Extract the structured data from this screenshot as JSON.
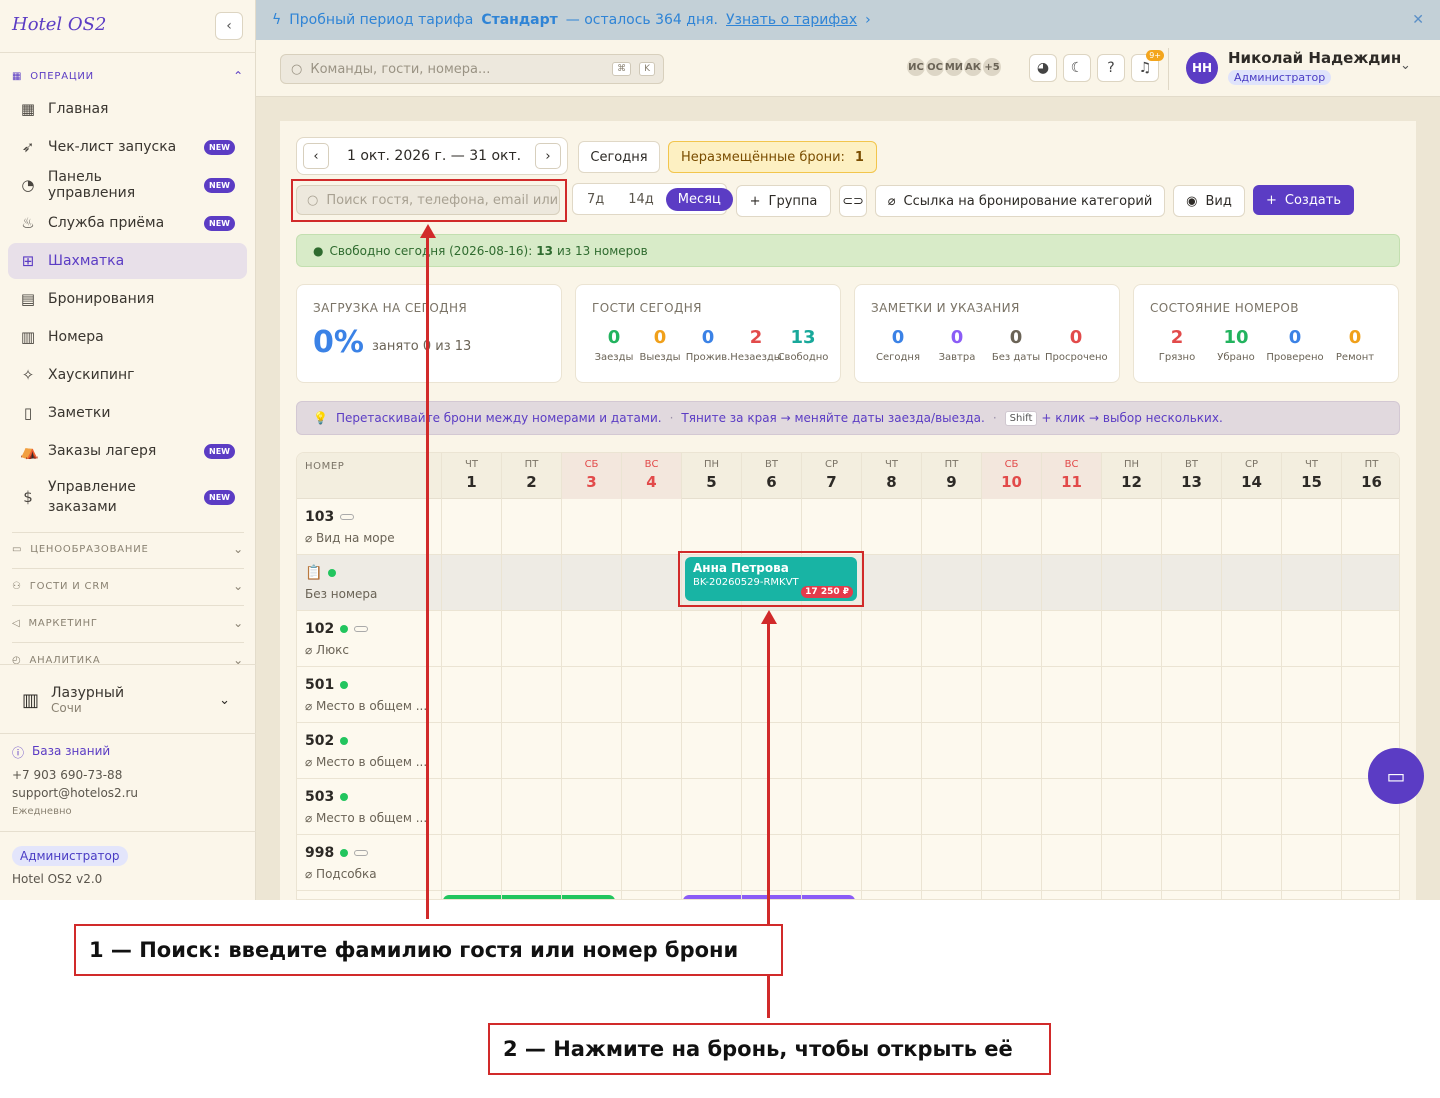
{
  "app": {
    "brand": "Hotel OS2",
    "version": "Hotel OS2 v2.0"
  },
  "banner": {
    "prefix": "Пробный период тарифа",
    "plan": "Стандарт",
    "suffix": "— осталось 364 дня.",
    "link": "Узнать о тарифах"
  },
  "sidebar": {
    "operations_label": "ОПЕРАЦИИ",
    "items": [
      {
        "label": "Главная",
        "icon": "dashboard-icon",
        "new": false
      },
      {
        "label": "Чек-лист запуска",
        "icon": "rocket-icon",
        "new": true
      },
      {
        "label": "Панель управления",
        "icon": "gauge-icon",
        "new": true
      },
      {
        "label": "Служба приёма",
        "icon": "bell-icon",
        "new": true
      },
      {
        "label": "Шахматка",
        "icon": "grid-icon",
        "new": false,
        "active": true
      },
      {
        "label": "Бронирования",
        "icon": "clipboard-icon",
        "new": false
      },
      {
        "label": "Номера",
        "icon": "building-icon",
        "new": false
      },
      {
        "label": "Хаускипинг",
        "icon": "sparkle-icon",
        "new": false
      },
      {
        "label": "Заметки",
        "icon": "note-icon",
        "new": false
      },
      {
        "label": "Заказы лагеря",
        "icon": "tent-icon",
        "new": true
      },
      {
        "label": "Управление заказами",
        "icon": "dollar-icon",
        "new": true
      }
    ],
    "new_badge": "NEW",
    "sections": [
      "ЦЕНООБРАЗОВАНИЕ",
      "ГОСТИ И CRM",
      "МАРКЕТИНГ",
      "АНАЛИТИКА"
    ],
    "hotel": {
      "name": "Лазурный",
      "city": "Сочи"
    },
    "kb_label": "База знаний",
    "phone": "+7 903 690-73-88",
    "email": "support@hotelos2.ru",
    "schedule": "Ежедневно",
    "role": "Администратор"
  },
  "header": {
    "search_placeholder": "Команды, гости, номера...",
    "kbd1": "⌘",
    "kbd2": "K",
    "avatars": [
      "ИС",
      "ОС",
      "МИ",
      "АК",
      "+5"
    ],
    "notif_count": "9+",
    "user": {
      "initials": "НН",
      "name": "Николай Надеждин",
      "role": "Администратор"
    }
  },
  "toolbar": {
    "date_range": "1 окт. 2026 г. — 31 окт.",
    "today": "Сегодня",
    "unplaced_label": "Неразмещённые брони:",
    "unplaced_count": "1",
    "guest_search_placeholder": "Поиск гостя, телефона, email или",
    "ranges": [
      "7д",
      "14д",
      "Месяц"
    ],
    "group": "Группа",
    "link_btn": "Ссылка на бронирование категорий",
    "view": "Вид",
    "create": "Создать"
  },
  "free_today": {
    "text": "Свободно сегодня (2026-08-16):",
    "free": "13",
    "rest": "из 13 номеров"
  },
  "cards": {
    "load": {
      "title": "ЗАГРУЗКА НА СЕГОДНЯ",
      "value": "0%",
      "sub": "занято 0 из 13"
    },
    "guests": {
      "title": "ГОСТИ СЕГОДНЯ",
      "stats": [
        {
          "v": "0",
          "l": "Заезды",
          "c": "#22b35e"
        },
        {
          "v": "0",
          "l": "Выезды",
          "c": "#f0a01a"
        },
        {
          "v": "0",
          "l": "Прожив.",
          "c": "#3b82e6"
        },
        {
          "v": "2",
          "l": "Незаезды",
          "c": "#e24a4a"
        },
        {
          "v": "13",
          "l": "Свободно",
          "c": "#18a89a"
        }
      ]
    },
    "notes": {
      "title": "ЗАМЕТКИ И УКАЗАНИЯ",
      "stats": [
        {
          "v": "0",
          "l": "Сегодня",
          "c": "#3b82e6"
        },
        {
          "v": "0",
          "l": "Завтра",
          "c": "#8b5cf6"
        },
        {
          "v": "0",
          "l": "Без даты",
          "c": "#6a6356"
        },
        {
          "v": "0",
          "l": "Просрочено",
          "c": "#e24a4a"
        }
      ]
    },
    "rooms": {
      "title": "СОСТОЯНИЕ НОМЕРОВ",
      "stats": [
        {
          "v": "2",
          "l": "Грязно",
          "c": "#e24a4a"
        },
        {
          "v": "10",
          "l": "Убрано",
          "c": "#22b35e"
        },
        {
          "v": "0",
          "l": "Проверено",
          "c": "#3b82e6"
        },
        {
          "v": "0",
          "l": "Ремонт",
          "c": "#f0a01a"
        }
      ]
    }
  },
  "tip": {
    "a": "Перетаскивайте брони между номерами и датами.",
    "b": "Тяните за края → меняйте даты заезда/выезда.",
    "key": "Shift",
    "c": "+ клик → выбор нескольких."
  },
  "grid": {
    "room_col": "НОМЕР",
    "days": [
      {
        "w": "ЧТ",
        "n": "1"
      },
      {
        "w": "ПТ",
        "n": "2"
      },
      {
        "w": "СБ",
        "n": "3",
        "we": true
      },
      {
        "w": "ВС",
        "n": "4",
        "we": true
      },
      {
        "w": "ПН",
        "n": "5"
      },
      {
        "w": "ВТ",
        "n": "6"
      },
      {
        "w": "СР",
        "n": "7"
      },
      {
        "w": "ЧТ",
        "n": "8"
      },
      {
        "w": "ПТ",
        "n": "9"
      },
      {
        "w": "СБ",
        "n": "10",
        "we": true
      },
      {
        "w": "ВС",
        "n": "11",
        "we": true
      },
      {
        "w": "ПН",
        "n": "12"
      },
      {
        "w": "ВТ",
        "n": "13"
      },
      {
        "w": "СР",
        "n": "14"
      },
      {
        "w": "ЧТ",
        "n": "15"
      },
      {
        "w": "ПТ",
        "n": "16"
      }
    ],
    "rooms": [
      {
        "num": "103",
        "cat": "Вид на море",
        "dot": false,
        "pill": true
      },
      {
        "num": "",
        "cat": "Без номера",
        "dot": true,
        "pill": false,
        "clip": true
      },
      {
        "num": "102",
        "cat": "Люкс",
        "dot": true,
        "pill": true
      },
      {
        "num": "501",
        "cat": "Место в общем ...",
        "dot": true,
        "pill": false
      },
      {
        "num": "502",
        "cat": "Место в общем ...",
        "dot": true,
        "pill": false
      },
      {
        "num": "503",
        "cat": "Место в общем ...",
        "dot": true,
        "pill": false
      },
      {
        "num": "998",
        "cat": "Подсобка",
        "dot": true,
        "pill": true
      }
    ],
    "booking": {
      "guest": "Анна Петрова",
      "code": "BK-20260529-RMKVT",
      "price": "17 250 ₽"
    }
  },
  "annotations": {
    "a1": "1 — Поиск: введите фамилию гостя или номер брони",
    "a2": "2 — Нажмите на бронь, чтобы открыть её"
  }
}
